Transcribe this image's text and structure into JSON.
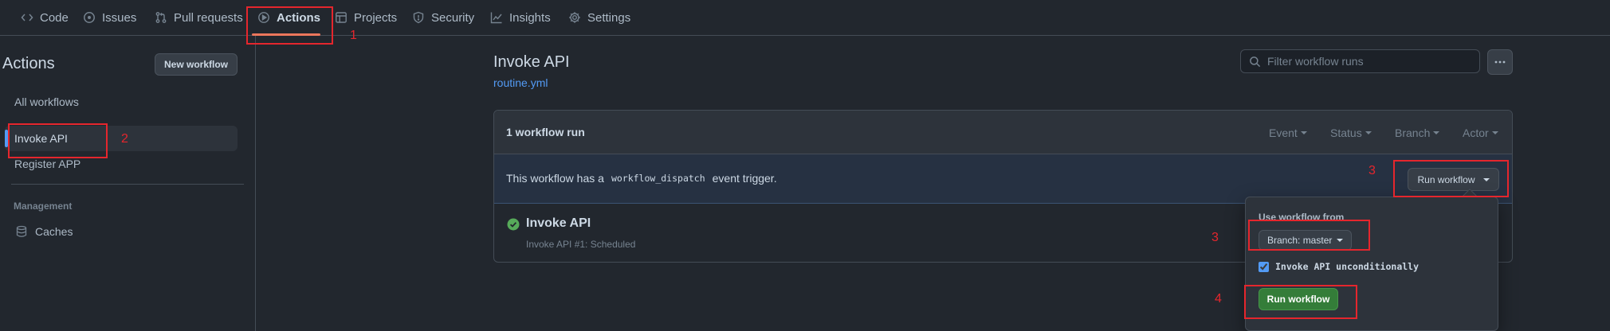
{
  "nav": {
    "code": "Code",
    "issues": "Issues",
    "pull_requests": "Pull requests",
    "actions": "Actions",
    "projects": "Projects",
    "security": "Security",
    "insights": "Insights",
    "settings": "Settings"
  },
  "sidebar": {
    "title": "Actions",
    "new_workflow": "New workflow",
    "all_workflows": "All workflows",
    "workflows": [
      "Invoke API",
      "Register APP"
    ],
    "management_heading": "Management",
    "caches": "Caches"
  },
  "main": {
    "title": "Invoke API",
    "file": "routine.yml",
    "filter_placeholder": "Filter workflow runs",
    "runs_count": "1 workflow run",
    "filters": [
      "Event",
      "Status",
      "Branch",
      "Actor"
    ],
    "dispatch_prefix": "This workflow has a",
    "dispatch_code": "workflow_dispatch",
    "dispatch_suffix": "event trigger.",
    "run_workflow_button": "Run workflow",
    "run": {
      "name": "Invoke API",
      "meta": "Invoke API #1: Scheduled",
      "status": "success"
    }
  },
  "popover": {
    "label": "Use workflow from",
    "branch": "Branch: master",
    "checkbox_label": "Invoke API unconditionally",
    "checkbox_checked": true,
    "submit": "Run workflow"
  },
  "annotations": [
    "1",
    "2",
    "3",
    "3",
    "4"
  ],
  "colors": {
    "background": "#22272e",
    "accent": "#539bf5",
    "nav_underline": "#ec775c",
    "success": "#57ab5a",
    "annotation": "#e5262d",
    "primary_button": "#347d39"
  }
}
